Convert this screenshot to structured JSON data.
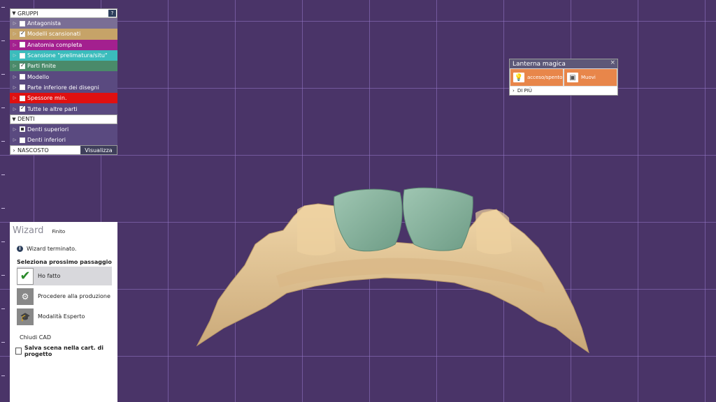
{
  "groups": {
    "header": "GRUPPI",
    "help": "?",
    "items": [
      {
        "label": "Antagonista",
        "checked": false,
        "color": "#7a6e95"
      },
      {
        "label": "Modelli scansionati",
        "checked": true,
        "color": "#c6a368"
      },
      {
        "label": "Anatomia completa",
        "checked": false,
        "color": "#a3208f"
      },
      {
        "label": "Scansione \"prelimatura/situ\"",
        "checked": false,
        "color": "#3bbcbc"
      },
      {
        "label": "Parti finite",
        "checked": true,
        "color": "#4a8a6a"
      },
      {
        "label": "Modello",
        "checked": false,
        "color": "#5a4a80"
      },
      {
        "label": "Parte inferiore dei disegni",
        "checked": false,
        "color": "#5a4a80"
      },
      {
        "label": "Spessore min.",
        "checked": false,
        "color": "#e01010"
      },
      {
        "label": "Tutte le altre parti",
        "checked": true,
        "color": "#5a4a80"
      }
    ],
    "teeth_header": "DENTI",
    "teeth": [
      {
        "label": "Denti superiori",
        "filled": true,
        "color": "#5a4a80"
      },
      {
        "label": "Denti inferiori",
        "filled": false,
        "color": "#5a4a80"
      }
    ],
    "footer_hidden": "NASCOSTO",
    "footer_show": "Visualizza"
  },
  "lantern": {
    "title": "Lanterna magica",
    "close": "×",
    "btn1": "acceso/spento",
    "btn2": "Muovi",
    "more": "DI PIÙ"
  },
  "wizard": {
    "title": "Wizard",
    "status": "Finito",
    "info": "Wizard terminato.",
    "next": "Seleziona prossimo passaggio",
    "steps": [
      {
        "label": "Ho fatto",
        "icon": "check-icon",
        "selected": true
      },
      {
        "label": "Procedere alla produzione",
        "icon": "production-icon",
        "selected": false
      },
      {
        "label": "Modalità Esperto",
        "icon": "graduation-cap-icon",
        "selected": false
      }
    ],
    "close_cad": "Chiudi CAD",
    "save_label": "Salva scena nella cart. di progetto"
  },
  "colors": {
    "background": "#4a3468",
    "model": "#e6c795",
    "crown": "#86b49c",
    "accent": "#e8864a"
  }
}
